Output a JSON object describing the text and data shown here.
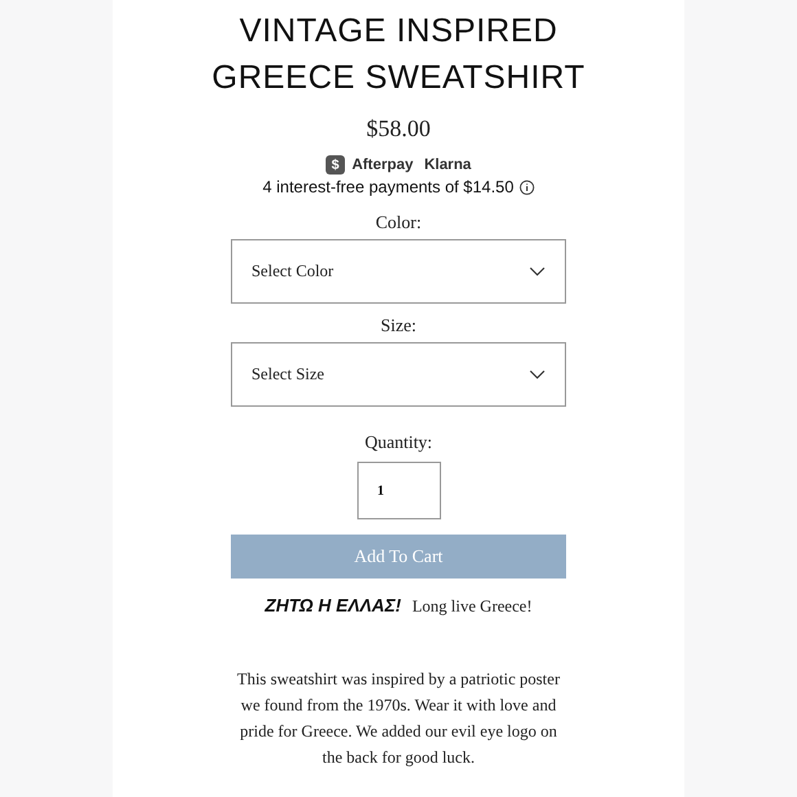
{
  "product": {
    "title": "VINTAGE INSPIRED GREECE SWEATSHIRT",
    "price": "$58.00"
  },
  "payments": {
    "afterpay_icon": "$",
    "afterpay": "Afterpay",
    "klarna": "Klarna",
    "installments": "4 interest-free payments of $14.50"
  },
  "options": [
    {
      "label": "Color:",
      "placeholder": "Select Color"
    },
    {
      "label": "Size:",
      "placeholder": "Select Size"
    }
  ],
  "quantity": {
    "label": "Quantity:",
    "value": "1"
  },
  "add_to_cart": {
    "label": "Add To Cart",
    "disabled": true
  },
  "tagline": {
    "greek": "ΖΗΤΩ Η ΕΛΛΑΣ!",
    "english": "Long live Greece!"
  },
  "description": "This sweatshirt was inspired by a patriotic poster we found from the 1970s. Wear it with love and pride for Greece. We added our evil eye logo on the back for good luck."
}
